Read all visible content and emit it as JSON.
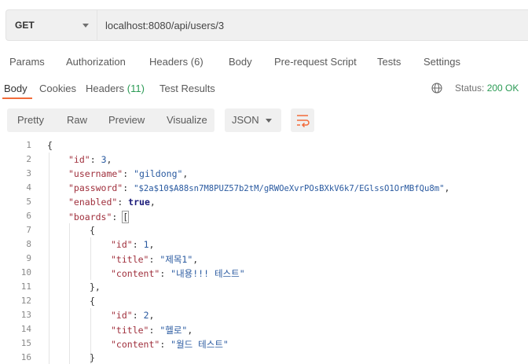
{
  "request": {
    "method": "GET",
    "url": "localhost:8080/api/users/3"
  },
  "request_tabs": {
    "params": "Params",
    "authorization": "Authorization",
    "headers": "Headers",
    "headers_count": "(6)",
    "body": "Body",
    "prerequest": "Pre-request Script",
    "tests": "Tests",
    "settings": "Settings"
  },
  "response_tabs": {
    "body": "Body",
    "cookies": "Cookies",
    "headers": "Headers",
    "headers_count": "(11)",
    "test_results": "Test Results",
    "status_label": "Status:",
    "status_value": "200 OK"
  },
  "toolbar": {
    "pretty": "Pretty",
    "raw": "Raw",
    "preview": "Preview",
    "visualize": "Visualize",
    "format": "JSON"
  },
  "code": {
    "line_numbers": [
      "1",
      "2",
      "3",
      "4",
      "5",
      "6",
      "7",
      "8",
      "9",
      "10",
      "11",
      "12",
      "13",
      "14",
      "15",
      "16"
    ],
    "l1": "{",
    "l2_key": "\"id\"",
    "l2_val": "3",
    "l3_key": "\"username\"",
    "l3_val": "\"gildong\"",
    "l4_key": "\"password\"",
    "l4_val": "\"$2a$10$A88sn7M8PUZ57b2tM/gRWOeXvrPOsBXkV6k7/EGlssO1OrMBfQu8m\"",
    "l5_key": "\"enabled\"",
    "l5_val": "true",
    "l6_key": "\"boards\"",
    "l6_val": "[",
    "l7": "{",
    "l8_key": "\"id\"",
    "l8_val": "1",
    "l9_key": "\"title\"",
    "l9_val": "\"제목1\"",
    "l10_key": "\"content\"",
    "l10_val": "\"내용!!! 테스트\"",
    "l11": "},",
    "l12": "{",
    "l13_key": "\"id\"",
    "l13_val": "2",
    "l14_key": "\"title\"",
    "l14_val": "\"헬로\"",
    "l15_key": "\"content\"",
    "l15_val": "\"월드 테스트\"",
    "l16": "}"
  }
}
